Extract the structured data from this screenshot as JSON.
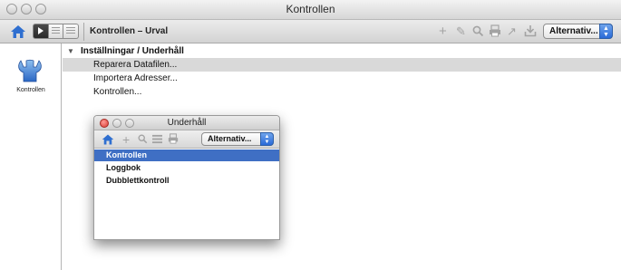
{
  "window": {
    "title": "Kontrollen"
  },
  "toolbar": {
    "breadcrumb": "Kontrollen – Urval",
    "icons": [
      "add-icon",
      "edit-icon",
      "search-icon",
      "print-icon",
      "export-icon",
      "import-icon"
    ],
    "popup_value": "Alternativ..."
  },
  "sidebar": {
    "items": [
      {
        "label": "Kontrollen",
        "icon": "wrench-icon"
      }
    ]
  },
  "tree": {
    "header": "Inställningar / Underhåll",
    "items": [
      {
        "label": "Reparera Datafilen...",
        "selected": true
      },
      {
        "label": "Importera Adresser..."
      },
      {
        "label": "Kontrollen..."
      }
    ]
  },
  "dialog": {
    "title": "Underhåll",
    "popup_value": "Alternativ...",
    "items": [
      {
        "label": "Kontrollen",
        "selected": true
      },
      {
        "label": "Loggbok"
      },
      {
        "label": "Dubblettkontroll"
      }
    ]
  },
  "colors": {
    "selection": "#3f6fc4",
    "accent": "#2a6ad8",
    "close_red": "#e0443e"
  }
}
